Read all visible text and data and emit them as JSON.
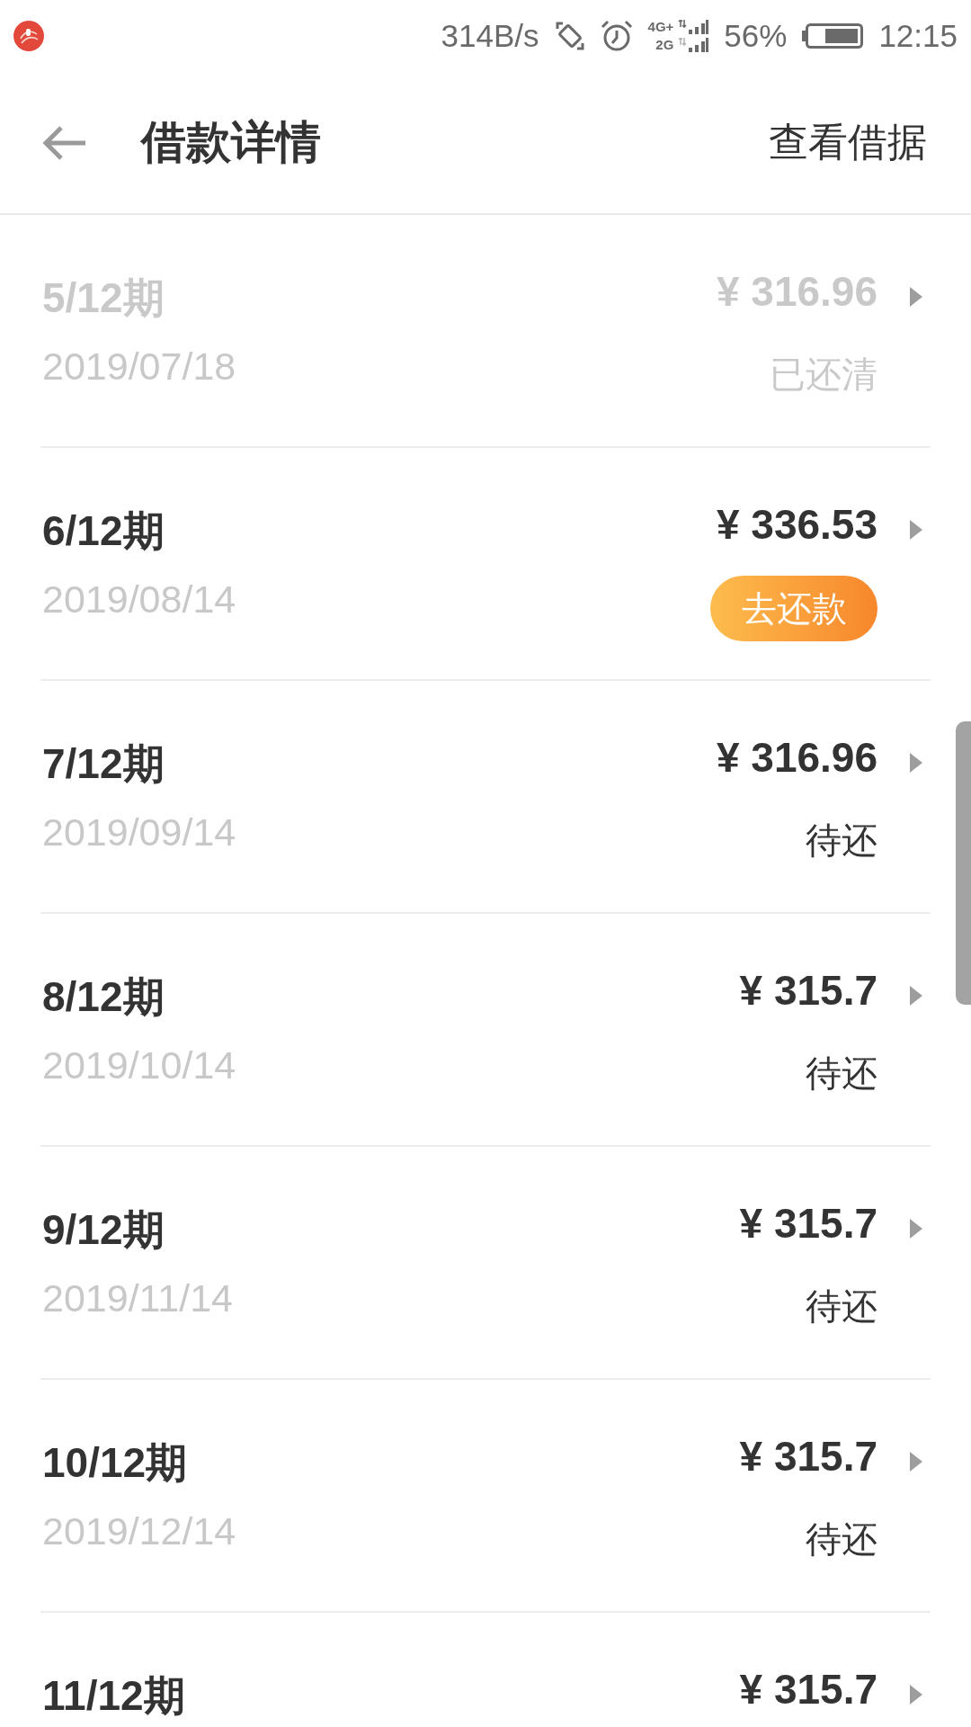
{
  "status_bar": {
    "network_speed": "314B/s",
    "network_types": [
      "4G+",
      "2G"
    ],
    "battery": "56%",
    "time": "12:15"
  },
  "header": {
    "title": "借款详情",
    "action": "查看借据"
  },
  "installments": [
    {
      "kind": "paid",
      "period": "5/12期",
      "date": "2019/07/18",
      "amount": "¥ 316.96",
      "status": "已还清"
    },
    {
      "kind": "due",
      "period": "6/12期",
      "date": "2019/08/14",
      "amount": "¥ 336.53",
      "action": "去还款"
    },
    {
      "kind": "pending",
      "period": "7/12期",
      "date": "2019/09/14",
      "amount": "¥ 316.96",
      "status": "待还"
    },
    {
      "kind": "pending",
      "period": "8/12期",
      "date": "2019/10/14",
      "amount": "¥ 315.7",
      "status": "待还"
    },
    {
      "kind": "pending",
      "period": "9/12期",
      "date": "2019/11/14",
      "amount": "¥ 315.7",
      "status": "待还"
    },
    {
      "kind": "pending",
      "period": "10/12期",
      "date": "2019/12/14",
      "amount": "¥ 315.7",
      "status": "待还"
    },
    {
      "kind": "pending",
      "period": "11/12期",
      "amount": "¥ 315.7"
    }
  ]
}
